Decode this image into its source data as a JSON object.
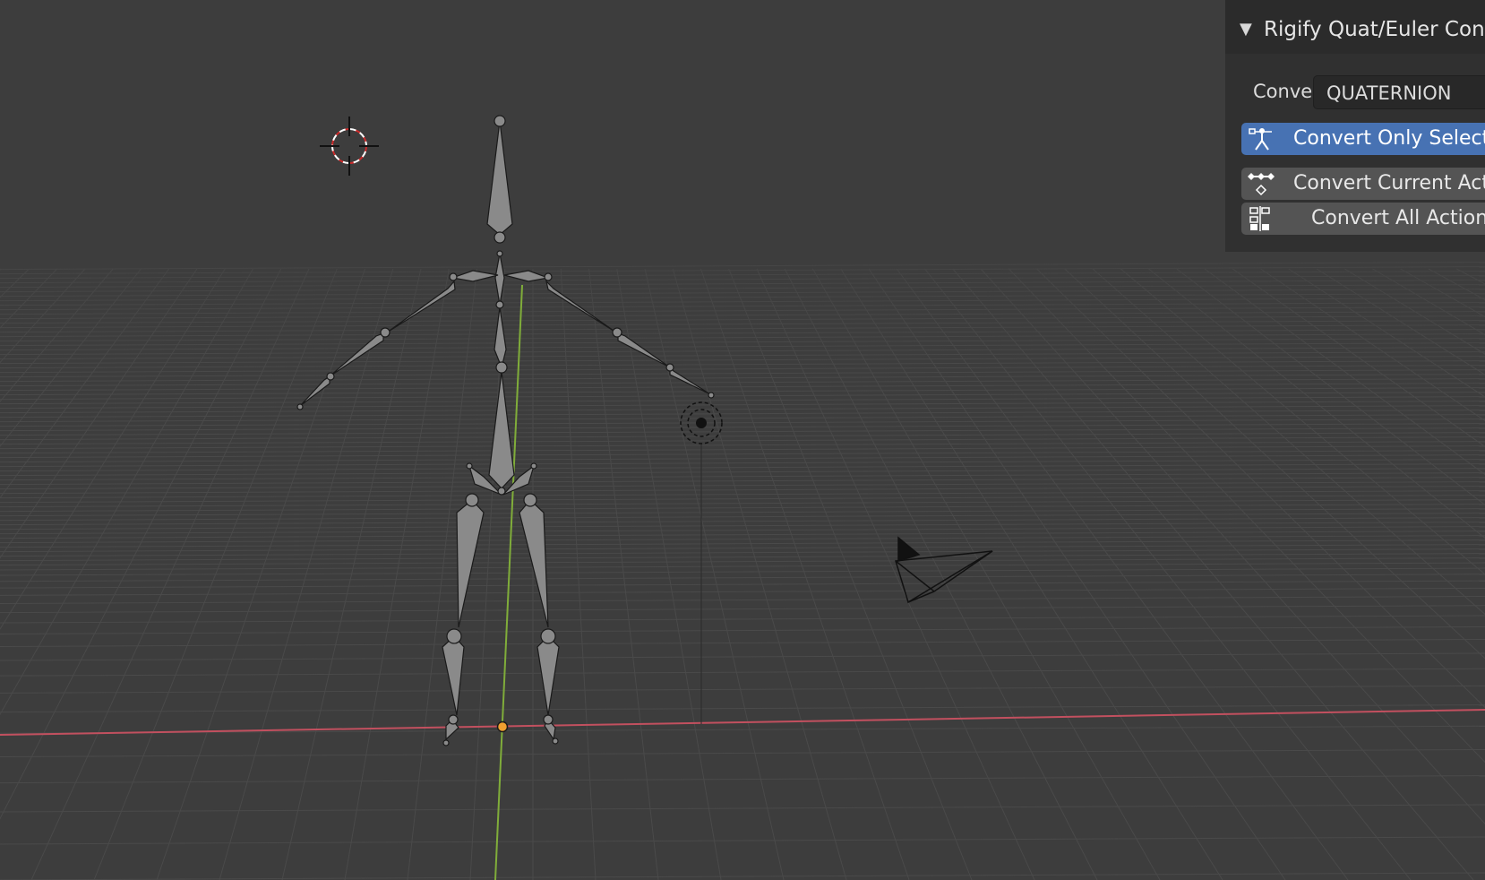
{
  "panel": {
    "title": "Rigify Quat/Euler Con",
    "collapse_icon": "triangle-down-icon",
    "convert_label": "Conve",
    "convert_value": "QUATERNION",
    "buttons": [
      {
        "label": "Convert Only Select",
        "icon": "armature-pose-icon",
        "active": true
      },
      {
        "label": "Convert Current Act",
        "icon": "keyframe-action-icon",
        "active": false
      },
      {
        "label": "Convert All Action",
        "icon": "action-list-icon",
        "active": false
      }
    ]
  },
  "viewport": {
    "objects": [
      "armature",
      "light",
      "camera",
      "3d-cursor",
      "origin-point"
    ],
    "colors": {
      "background": "#3d3d3d",
      "grid": "#4a4a4a",
      "x_axis": "#c2505f",
      "y_axis": "#80ad3a",
      "bone": "#8a8a8a",
      "origin": "#f0a030",
      "active_button": "#4772b3"
    }
  }
}
